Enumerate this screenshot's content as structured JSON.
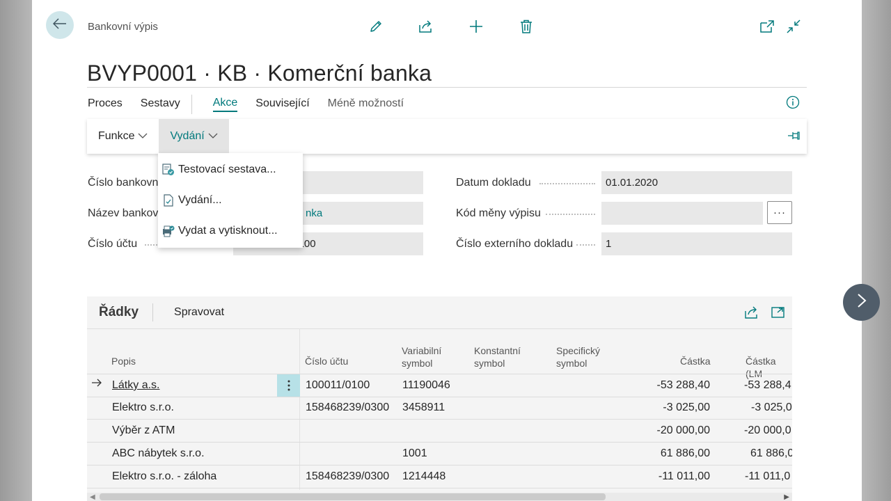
{
  "header": {
    "breadcrumb": "Bankovní výpis",
    "title": "BVYP0001 · KB · Komerční banka"
  },
  "toolbar_icons": [
    "pencil-edit-icon",
    "share-icon",
    "plus-icon",
    "trash-icon"
  ],
  "window_icons": [
    "open-new-window-icon",
    "collapse-icon"
  ],
  "actionbar": {
    "items": [
      "Proces",
      "Sestavy",
      "Akce",
      "Související",
      "Méně možností"
    ],
    "active": "Akce"
  },
  "submenu": {
    "funkce": "Funkce",
    "vydani": "Vydání"
  },
  "dropdown": {
    "items": [
      "Testovací sestava...",
      "Vydání...",
      "Vydat a vytisknout..."
    ]
  },
  "fields": {
    "cislo_bankovniho_label": "Číslo bankovn",
    "nazev_bankovniho_label": "Název bankov",
    "nazev_bankovniho_value": "nka",
    "cislo_uctu_label": "Číslo účtu",
    "cislo_uctu_value": "158316358/0100",
    "datum_dokladu_label": "Datum dokladu",
    "datum_dokladu_value": "01.01.2020",
    "kod_meny_label": "Kód měny výpisu",
    "kod_meny_value": "",
    "cislo_ext_label": "Číslo externího dokladu",
    "cislo_ext_value": "1",
    "ellipsis": "···"
  },
  "lines": {
    "title": "Řádky",
    "manage": "Spravovat",
    "columns": [
      "Popis",
      "Číslo účtu",
      "Variabilní symbol",
      "Konstantní symbol",
      "Specifický symbol",
      "Částka",
      "Částka (LM"
    ],
    "rows": [
      {
        "popis": "Látky a.s.",
        "ucet": "100011/0100",
        "vs": "11190046",
        "castka": "-53 288,40",
        "castka_lm": "-53 288,4"
      },
      {
        "popis": "Elektro s.r.o.",
        "ucet": "158468239/0300",
        "vs": "3458911",
        "castka": "-3 025,00",
        "castka_lm": "-3 025,0"
      },
      {
        "popis": "Výběr z ATM",
        "ucet": "",
        "vs": "",
        "castka": "-20 000,00",
        "castka_lm": "-20 000,0"
      },
      {
        "popis": "ABC nábytek s.r.o.",
        "ucet": "",
        "vs": "1001",
        "castka": "61 886,00",
        "castka_lm": "61 886,0"
      },
      {
        "popis": "Elektro s.r.o. - záloha",
        "ucet": "158468239/0300",
        "vs": "1214448",
        "castka": "-11 011,00",
        "castka_lm": "-11 011,0"
      }
    ]
  },
  "colors": {
    "accent": "#00797c",
    "open_tab_bg": "#e4e4e4",
    "field_bg": "#e8e8e8",
    "row_menu_bg": "#b7e1e7",
    "next_button_bg": "#505d6a"
  }
}
